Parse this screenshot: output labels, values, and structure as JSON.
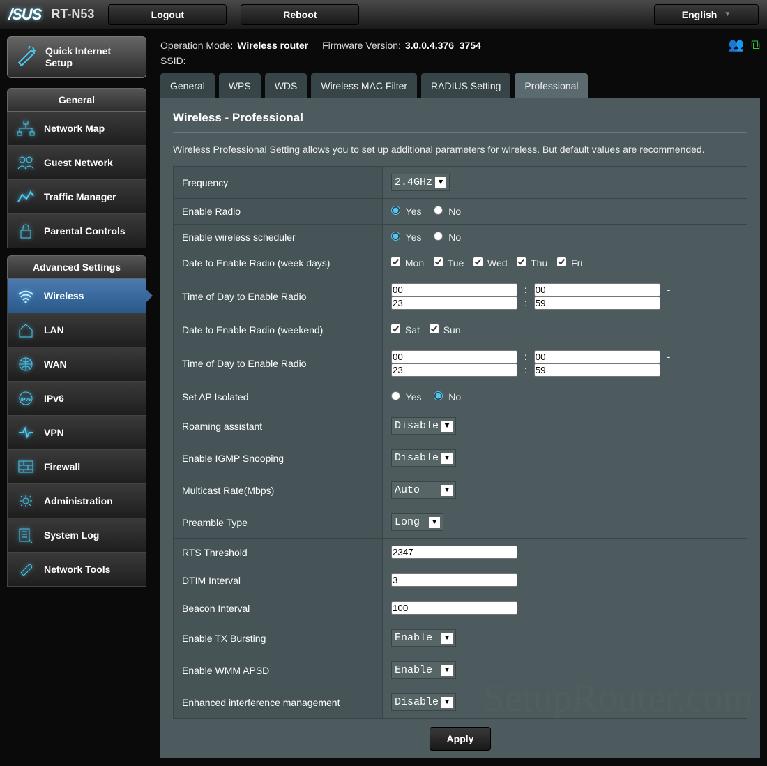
{
  "header": {
    "logo": "/SUS",
    "model": "RT-N53",
    "logout": "Logout",
    "reboot": "Reboot",
    "language": "English"
  },
  "info": {
    "op_mode_label": "Operation Mode:",
    "op_mode_value": "Wireless router",
    "fw_label": "Firmware Version:",
    "fw_value": "3.0.0.4.376_3754",
    "ssid_label": "SSID:"
  },
  "sidebar": {
    "qis": "Quick Internet Setup",
    "general_header": "General",
    "general_items": [
      "Network Map",
      "Guest Network",
      "Traffic Manager",
      "Parental Controls"
    ],
    "advanced_header": "Advanced Settings",
    "advanced_items": [
      "Wireless",
      "LAN",
      "WAN",
      "IPv6",
      "VPN",
      "Firewall",
      "Administration",
      "System Log",
      "Network Tools"
    ]
  },
  "tabs": [
    "General",
    "WPS",
    "WDS",
    "Wireless MAC Filter",
    "RADIUS Setting",
    "Professional"
  ],
  "panel": {
    "title": "Wireless - Professional",
    "desc": "Wireless Professional Setting allows you to set up additional parameters for wireless. But default values are recommended."
  },
  "settings": {
    "frequency": {
      "label": "Frequency",
      "value": "2.4GHz"
    },
    "enable_radio": {
      "label": "Enable Radio",
      "yes": "Yes",
      "no": "No"
    },
    "enable_sched": {
      "label": "Enable wireless scheduler",
      "yes": "Yes",
      "no": "No"
    },
    "date_week": {
      "label": "Date to Enable Radio (week days)",
      "days": [
        "Mon",
        "Tue",
        "Wed",
        "Thu",
        "Fri"
      ]
    },
    "time_week": {
      "label": "Time of Day to Enable Radio",
      "h1": "00",
      "m1": "00",
      "h2": "23",
      "m2": "59"
    },
    "date_weekend": {
      "label": "Date to Enable Radio (weekend)",
      "days": [
        "Sat",
        "Sun"
      ]
    },
    "time_weekend": {
      "label": "Time of Day to Enable Radio",
      "h1": "00",
      "m1": "00",
      "h2": "23",
      "m2": "59"
    },
    "ap_isolated": {
      "label": "Set AP Isolated",
      "yes": "Yes",
      "no": "No"
    },
    "roaming": {
      "label": "Roaming assistant",
      "value": "Disable"
    },
    "igmp": {
      "label": "Enable IGMP Snooping",
      "value": "Disable"
    },
    "multicast": {
      "label": "Multicast Rate(Mbps)",
      "value": "Auto"
    },
    "preamble": {
      "label": "Preamble Type",
      "value": "Long"
    },
    "rts": {
      "label": "RTS Threshold",
      "value": "2347"
    },
    "dtim": {
      "label": "DTIM Interval",
      "value": "3"
    },
    "beacon": {
      "label": "Beacon Interval",
      "value": "100"
    },
    "tx_burst": {
      "label": "Enable TX Bursting",
      "value": "Enable"
    },
    "wmm": {
      "label": "Enable WMM APSD",
      "value": "Enable"
    },
    "interference": {
      "label": "Enhanced interference management",
      "value": "Disable"
    }
  },
  "apply": "Apply",
  "watermark": "SetupRouter.com"
}
